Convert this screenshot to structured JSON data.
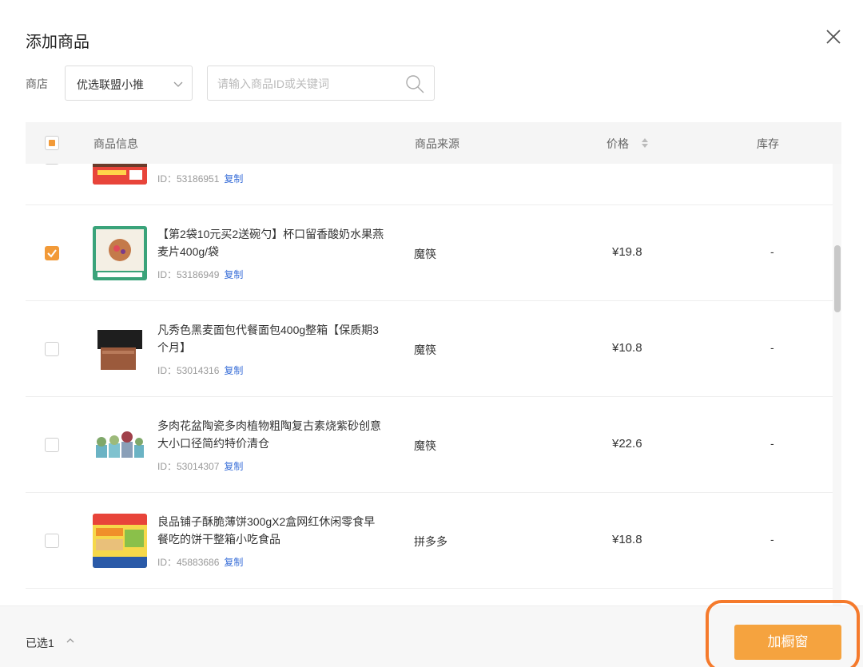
{
  "dialog": {
    "title": "添加商品",
    "close_icon": "close-icon"
  },
  "filter": {
    "shop_label": "商店",
    "shop_value": "优选联盟小推",
    "search_placeholder": "请输入商品ID或关键词"
  },
  "table": {
    "headers": {
      "info": "商品信息",
      "source": "商品来源",
      "price": "价格",
      "stock": "库存"
    },
    "select_all_state": "indeterminate",
    "rows": [
      {
        "name": "",
        "id_label": "ID：53186951",
        "copy": "复制",
        "source": "",
        "price": "",
        "stock": "",
        "checked": false
      },
      {
        "name": "【第2袋10元买2送碗勺】杯口留香酸奶水果燕麦片400g/袋",
        "id_label": "ID：53186949",
        "copy": "复制",
        "source": "魔筷",
        "price": "¥19.8",
        "stock": "-",
        "checked": true
      },
      {
        "name": "凡秀色黑麦面包代餐面包400g整箱【保质期3个月】",
        "id_label": "ID：53014316",
        "copy": "复制",
        "source": "魔筷",
        "price": "¥10.8",
        "stock": "-",
        "checked": false
      },
      {
        "name": "多肉花盆陶瓷多肉植物粗陶复古素烧紫砂创意大小口径简约特价清仓",
        "id_label": "ID：53014307",
        "copy": "复制",
        "source": "魔筷",
        "price": "¥22.6",
        "stock": "-",
        "checked": false
      },
      {
        "name": "良品铺子酥脆薄饼300gX2盒网红休闲零食早餐吃的饼干整箱小吃食品",
        "id_label": "ID：45883686",
        "copy": "复制",
        "source": "拼多多",
        "price": "¥18.8",
        "stock": "-",
        "checked": false
      }
    ]
  },
  "footer": {
    "selected_label": "已选1",
    "add_button_label": "加橱窗"
  },
  "colors": {
    "accent": "#f5a33f",
    "checkbox_checked": "#f29a38",
    "link": "#3a6fd8",
    "highlight": "#f57a2c"
  }
}
